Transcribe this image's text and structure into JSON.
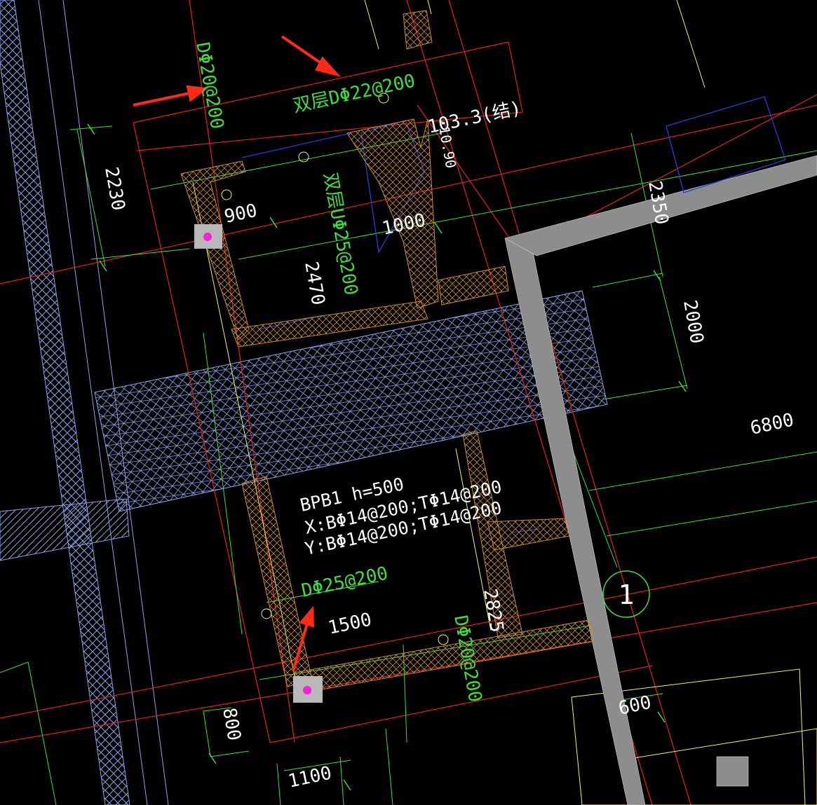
{
  "viewport": {
    "background": "#000000",
    "colors": {
      "red": "#e0201e",
      "yellow": "#f2f27a",
      "green": "#3fdc3f",
      "white": "#ffffff",
      "blue": "#2a3cd6",
      "hatch": "#8aa3e6",
      "orange": "#c98a3c",
      "gray": "#8d8d8d",
      "arrow": "#ff2a1a",
      "magenta": "#ff1ed8"
    }
  },
  "labels": {
    "rebar_top_left": "DΦ20@200",
    "rebar_top_double": "双层DΦ22@200",
    "rebar_vertical_double": "双层UΦ25@200",
    "level_mark": "103.3(结)",
    "level_mark_under": "-10.90",
    "dim_2230": "2230",
    "dim_900": "900",
    "dim_2470": "2470",
    "dim_1000": "1000",
    "dim_2350": "2350",
    "dim_2000": "2000",
    "dim_6800": "6800",
    "slab_name": "BPB1 h=500",
    "slab_x": "X:BΦ14@200;TΦ14@200",
    "slab_y": "Y:BΦ14@200;TΦ14@200",
    "rebar_bottom": "DΦ25@200",
    "rebar_right": "DΦ20@200",
    "dim_1500": "1500",
    "dim_2825": "2825",
    "dim_600": "600",
    "dim_800": "800",
    "dim_1100": "1100",
    "axis_1": "1"
  }
}
